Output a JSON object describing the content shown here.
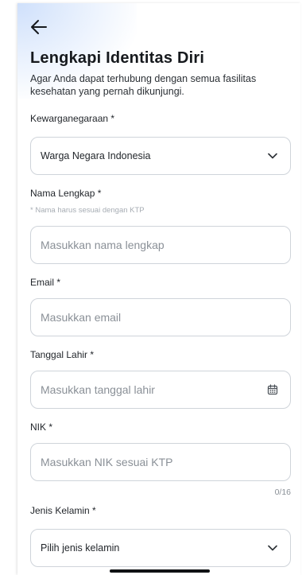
{
  "header": {
    "title": "Lengkapi Identitas Diri",
    "subtitle": "Agar Anda dapat terhubung dengan semua fasilitas kesehatan yang pernah dikunjungi."
  },
  "form": {
    "nationality": {
      "label": "Kewarganegaraan *",
      "value": "Warga Negara Indonesia"
    },
    "full_name": {
      "label": "Nama Lengkap *",
      "hint": "* Nama harus sesuai dengan KTP",
      "placeholder": "Masukkan nama lengkap"
    },
    "email": {
      "label": "Email *",
      "placeholder": "Masukkan email"
    },
    "birth_date": {
      "label": "Tanggal Lahir *",
      "placeholder": "Masukkan tanggal lahir"
    },
    "nik": {
      "label": "NIK *",
      "placeholder": "Masukkan NIK sesuai KTP",
      "counter": "0/16"
    },
    "gender": {
      "label": "Jenis Kelamin *",
      "value": "Pilih jenis kelamin"
    }
  },
  "icons": {
    "back": "arrow-left-icon",
    "dropdown": "chevron-down-icon",
    "calendar": "calendar-icon"
  },
  "colors": {
    "border": "#cfd4da",
    "placeholder": "#8a9097",
    "hint": "#a7adb4",
    "header_glow": "#cfe0fb"
  }
}
